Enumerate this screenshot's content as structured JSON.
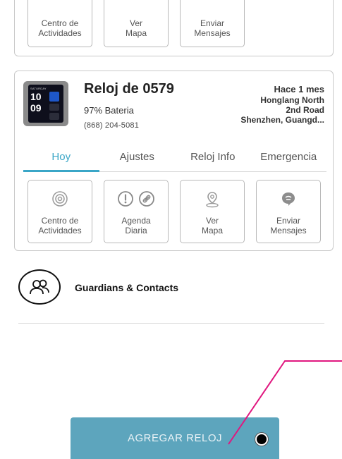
{
  "top_card": {
    "tiles": [
      {
        "label": "Centro de\nActividades",
        "icon": "activity-rings-icon"
      },
      {
        "label": "Ver\nMapa",
        "icon": "map-pin-icon"
      },
      {
        "label": "Enviar\nMensajes",
        "icon": "chat-bubble-icon"
      }
    ]
  },
  "device": {
    "watch_face": {
      "day": "SATURDAY",
      "hour": "10",
      "minute": "09"
    },
    "title": "Reloj de 0579",
    "battery": "97% Bateria",
    "phone": "(868) 204-5081",
    "last_seen": "Hace 1 mes",
    "address": "Honglang North\n2nd Road\nShenzhen, Guangd..."
  },
  "tabs": [
    {
      "label": "Hoy",
      "active": true
    },
    {
      "label": "Ajustes",
      "active": false
    },
    {
      "label": "Reloj Info",
      "active": false
    },
    {
      "label": "Emergencia",
      "active": false
    }
  ],
  "main_tiles": [
    {
      "label": "Centro de\nActividades",
      "icon": "activity-rings-icon"
    },
    {
      "label": "Agenda\nDiaria",
      "icon": "alert-and-link-icons"
    },
    {
      "label": "Ver\nMapa",
      "icon": "map-pin-icon"
    },
    {
      "label": "Enviar\nMensajes",
      "icon": "chat-bubble-icon"
    }
  ],
  "guardians": {
    "label": "Guardians & Contacts",
    "icon": "people-icon"
  },
  "add_button": {
    "label": "AGREGAR RELOJ"
  },
  "colors": {
    "accent": "#3aa6c7",
    "button": "#5da5bd",
    "annotation": "#e0177f"
  }
}
